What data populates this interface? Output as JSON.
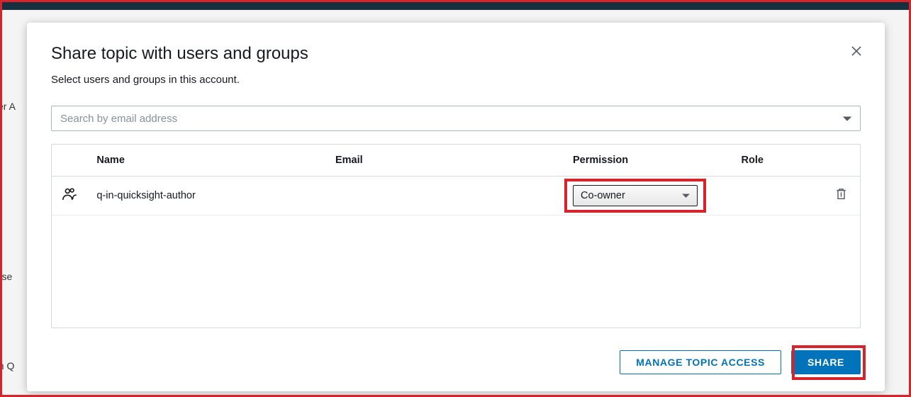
{
  "modal": {
    "title": "Share topic with users and groups",
    "subtitle": "Select users and groups in this account."
  },
  "search": {
    "placeholder": "Search by email address"
  },
  "table": {
    "headers": {
      "name": "Name",
      "email": "Email",
      "permission": "Permission",
      "role": "Role"
    },
    "rows": [
      {
        "icon": "group-icon",
        "name": "q-in-quicksight-author",
        "email": "",
        "permission": "Co-owner",
        "role": ""
      }
    ]
  },
  "footer": {
    "manage_label": "MANAGE TOPIC ACCESS",
    "share_label": "SHARE"
  },
  "background": {
    "frag1": "ser A",
    "frag2": "-use",
    "frag3": "on Q"
  }
}
